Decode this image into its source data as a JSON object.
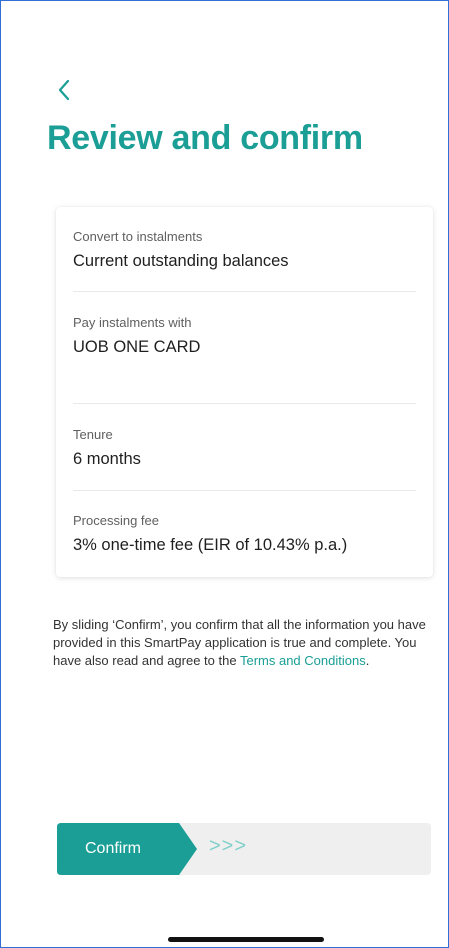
{
  "header": {
    "title": "Review and confirm"
  },
  "summary": {
    "rows": [
      {
        "label": "Convert to instalments",
        "value": "Current outstanding balances"
      },
      {
        "label": "Pay instalments with",
        "value": "UOB ONE CARD"
      },
      {
        "label": "Tenure",
        "value": "6 months"
      },
      {
        "label": "Processing fee",
        "value": "3% one-time fee (EIR of 10.43% p.a.)"
      }
    ]
  },
  "disclaimer": {
    "text": "By sliding ‘Confirm’, you confirm that all the information you have provided in this SmartPay application is true and complete. You have also read and agree to the ",
    "link_text": "Terms and Conditions",
    "suffix": "."
  },
  "slider": {
    "label": "Confirm",
    "hint": ">>>"
  },
  "icons": {
    "back": "chevron-left-icon",
    "slider_hint": "triple-chevron-right-icon"
  },
  "colors": {
    "accent": "#1a9e95",
    "accent_light": "#7fd0c9",
    "track": "#efefef",
    "frame_border": "#2f6fd6"
  }
}
